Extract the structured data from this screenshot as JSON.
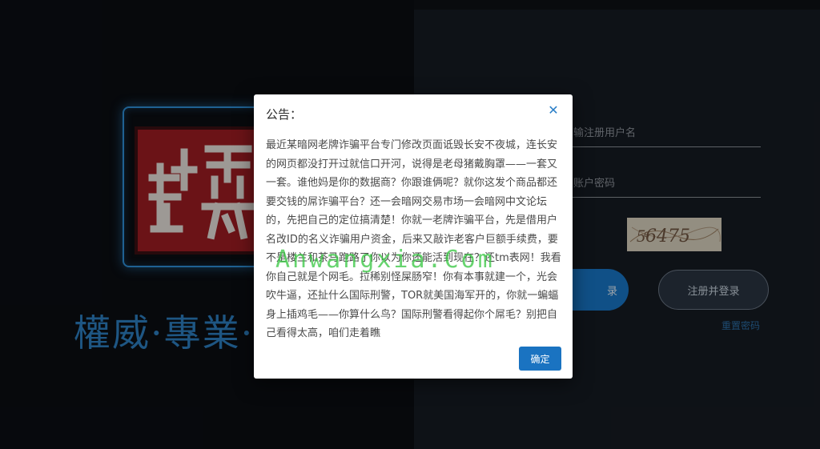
{
  "slogan": "權威·專業·",
  "login_form": {
    "username_placeholder": "输注册用户名",
    "password_placeholder": "账户密码",
    "captcha_text": "5ͤ6475",
    "login_label": "录",
    "register_label": "注册并登录",
    "reset_link": "重置密码"
  },
  "modal": {
    "title": "公告：",
    "close_icon": "close-icon",
    "body": "最近某暗网老牌诈骗平台专门修改页面诋毁长安不夜城，连长安的网页都没打开过就信口开河，说得是老母猪戴胸罩——一套又一套。谁他妈是你的数据商？你跟谁俩呢？就你这发个商品都还要交钱的屌诈骗平台？还一会暗网交易市场一会暗网中文论坛的，先把自己的定位搞清楚！你就一老牌诈骗平台，先是借用户名改ID的名义诈骗用户资金，后来又敲诈老客户巨额手续费，要不是楼兰和茶马跑路了你以为你还能活到现在？还tm表网！我看你自己就是个网毛。拉稀别怪屎肠窄！你有本事就建一个，光会吹牛逼，还扯什么国际刑警，TOR就美国海军开的，你就一蝙蝠身上插鸡毛——你算什么鸟？国际刑警看得起你个屌毛？别把自己看得太高，咱们走着瞧",
    "ok_label": "确定"
  },
  "watermark": "Anwangxia.Com",
  "colors": {
    "accent": "#1a73c1",
    "seal_red": "#9e1c22",
    "slogan_blue": "#2d7fc2"
  }
}
